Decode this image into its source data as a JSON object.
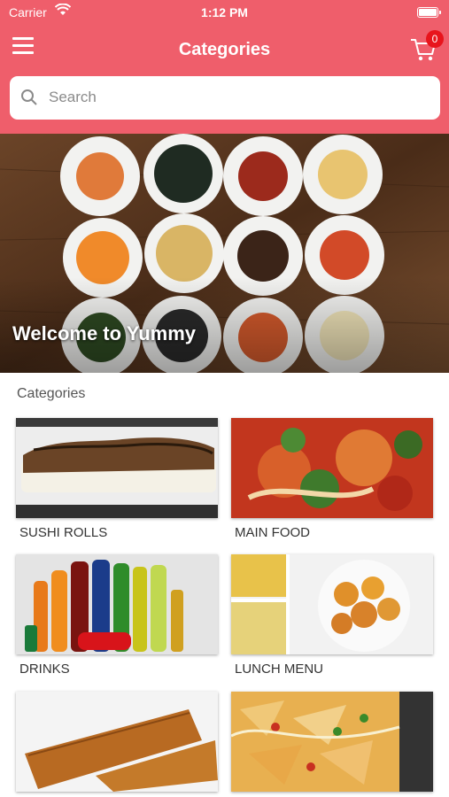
{
  "status_bar": {
    "carrier": "Carrier",
    "time": "1:12 PM"
  },
  "header": {
    "title": "Categories",
    "cart_count": "0"
  },
  "search": {
    "placeholder": "Search"
  },
  "hero": {
    "text": "Welcome to Yummy"
  },
  "section": {
    "label": "Categories"
  },
  "categories": [
    {
      "label": "SUSHI ROLLS"
    },
    {
      "label": "MAIN FOOD"
    },
    {
      "label": "DRINKS"
    },
    {
      "label": "LUNCH MENU"
    },
    {
      "label": ""
    },
    {
      "label": ""
    }
  ],
  "colors": {
    "header": "#ef5e6b",
    "badge": "#e8141c"
  }
}
